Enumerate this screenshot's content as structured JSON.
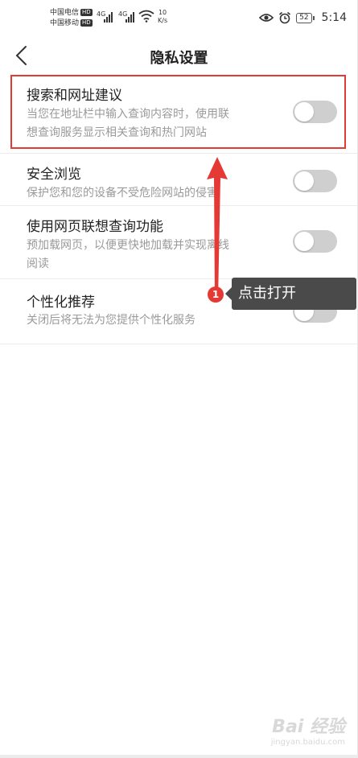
{
  "status_bar": {
    "carrier1": "中国电信",
    "carrier2": "中国移动",
    "hd": "HD",
    "network1": "4G",
    "network2": "4G",
    "speed_value": "10",
    "speed_unit": "K/s",
    "battery": "52",
    "time": "5:14"
  },
  "header": {
    "title": "隐私设置"
  },
  "settings": [
    {
      "title": "搜索和网址建议",
      "desc_line1": "当您在地址栏中输入查询内容时，使用联",
      "desc_line2": "想查询服务显示相关查询和热门网站",
      "enabled": false
    },
    {
      "title": "安全浏览",
      "desc_line1": "保护您和您的设备不受危险网站的侵害",
      "enabled": false
    },
    {
      "title": "使用网页联想查询功能",
      "desc_line1": "预加载网页，以便更快地加载并实现离线",
      "desc_line2": "阅读",
      "enabled": false
    },
    {
      "title": "个性化推荐",
      "desc_line1": "关闭后将无法为您提供个性化服务",
      "enabled": false
    }
  ],
  "annotation": {
    "step": "1",
    "text": "点击打开",
    "highlight_color": "#e53935"
  },
  "watermark": {
    "logo": "Bai 经验",
    "sub": "jingyan.baidu.com"
  },
  "colors": {
    "toggle_off": "#cfcfcf",
    "accent_red": "#e53935",
    "tooltip_bg": "#4a4a4a"
  }
}
